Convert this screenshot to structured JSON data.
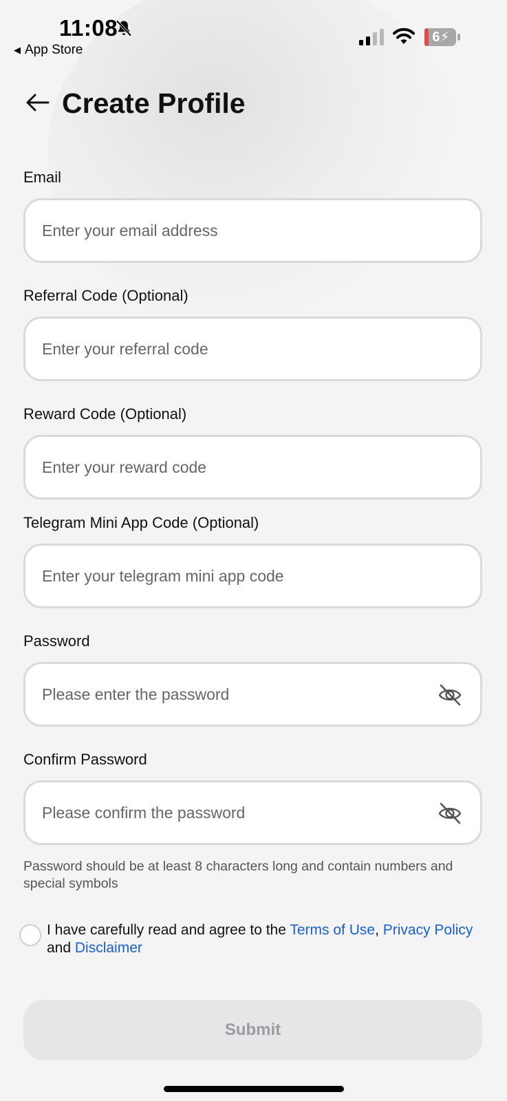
{
  "status_bar": {
    "time": "11:08",
    "back_app": "App Store",
    "battery": "6"
  },
  "header": {
    "title": "Create Profile"
  },
  "form": {
    "email": {
      "label": "Email",
      "placeholder": "Enter your email address"
    },
    "referral": {
      "label": "Referral Code (Optional)",
      "placeholder": "Enter your referral code"
    },
    "reward": {
      "label": "Reward Code (Optional)",
      "placeholder": "Enter your reward code"
    },
    "telegram": {
      "label": "Telegram Mini App Code (Optional)",
      "placeholder": "Enter your telegram mini app code"
    },
    "password": {
      "label": "Password",
      "placeholder": "Please enter the password"
    },
    "confirm_password": {
      "label": "Confirm Password",
      "placeholder": "Please confirm the password"
    },
    "password_hint": "Password should be at least 8 characters long and contain numbers and special symbols"
  },
  "agreement": {
    "prefix": "I have carefully read and agree to the ",
    "terms": "Terms of Use",
    "comma": ", ",
    "privacy": "Privacy Policy",
    "and": " and ",
    "disclaimer": "Disclaimer"
  },
  "submit_label": "Submit",
  "icons": {
    "bell": "bell-slash-icon",
    "signal": "cellular-signal-icon",
    "wifi": "wifi-icon",
    "battery": "battery-charging-icon",
    "back": "back-arrow-icon",
    "eye": "eye-slash-icon"
  },
  "colors": {
    "link": "#1a5fd0",
    "submit_bg": "#e6e6e8",
    "submit_text": "#9a9ca0",
    "battery_low": "#e5484d"
  }
}
